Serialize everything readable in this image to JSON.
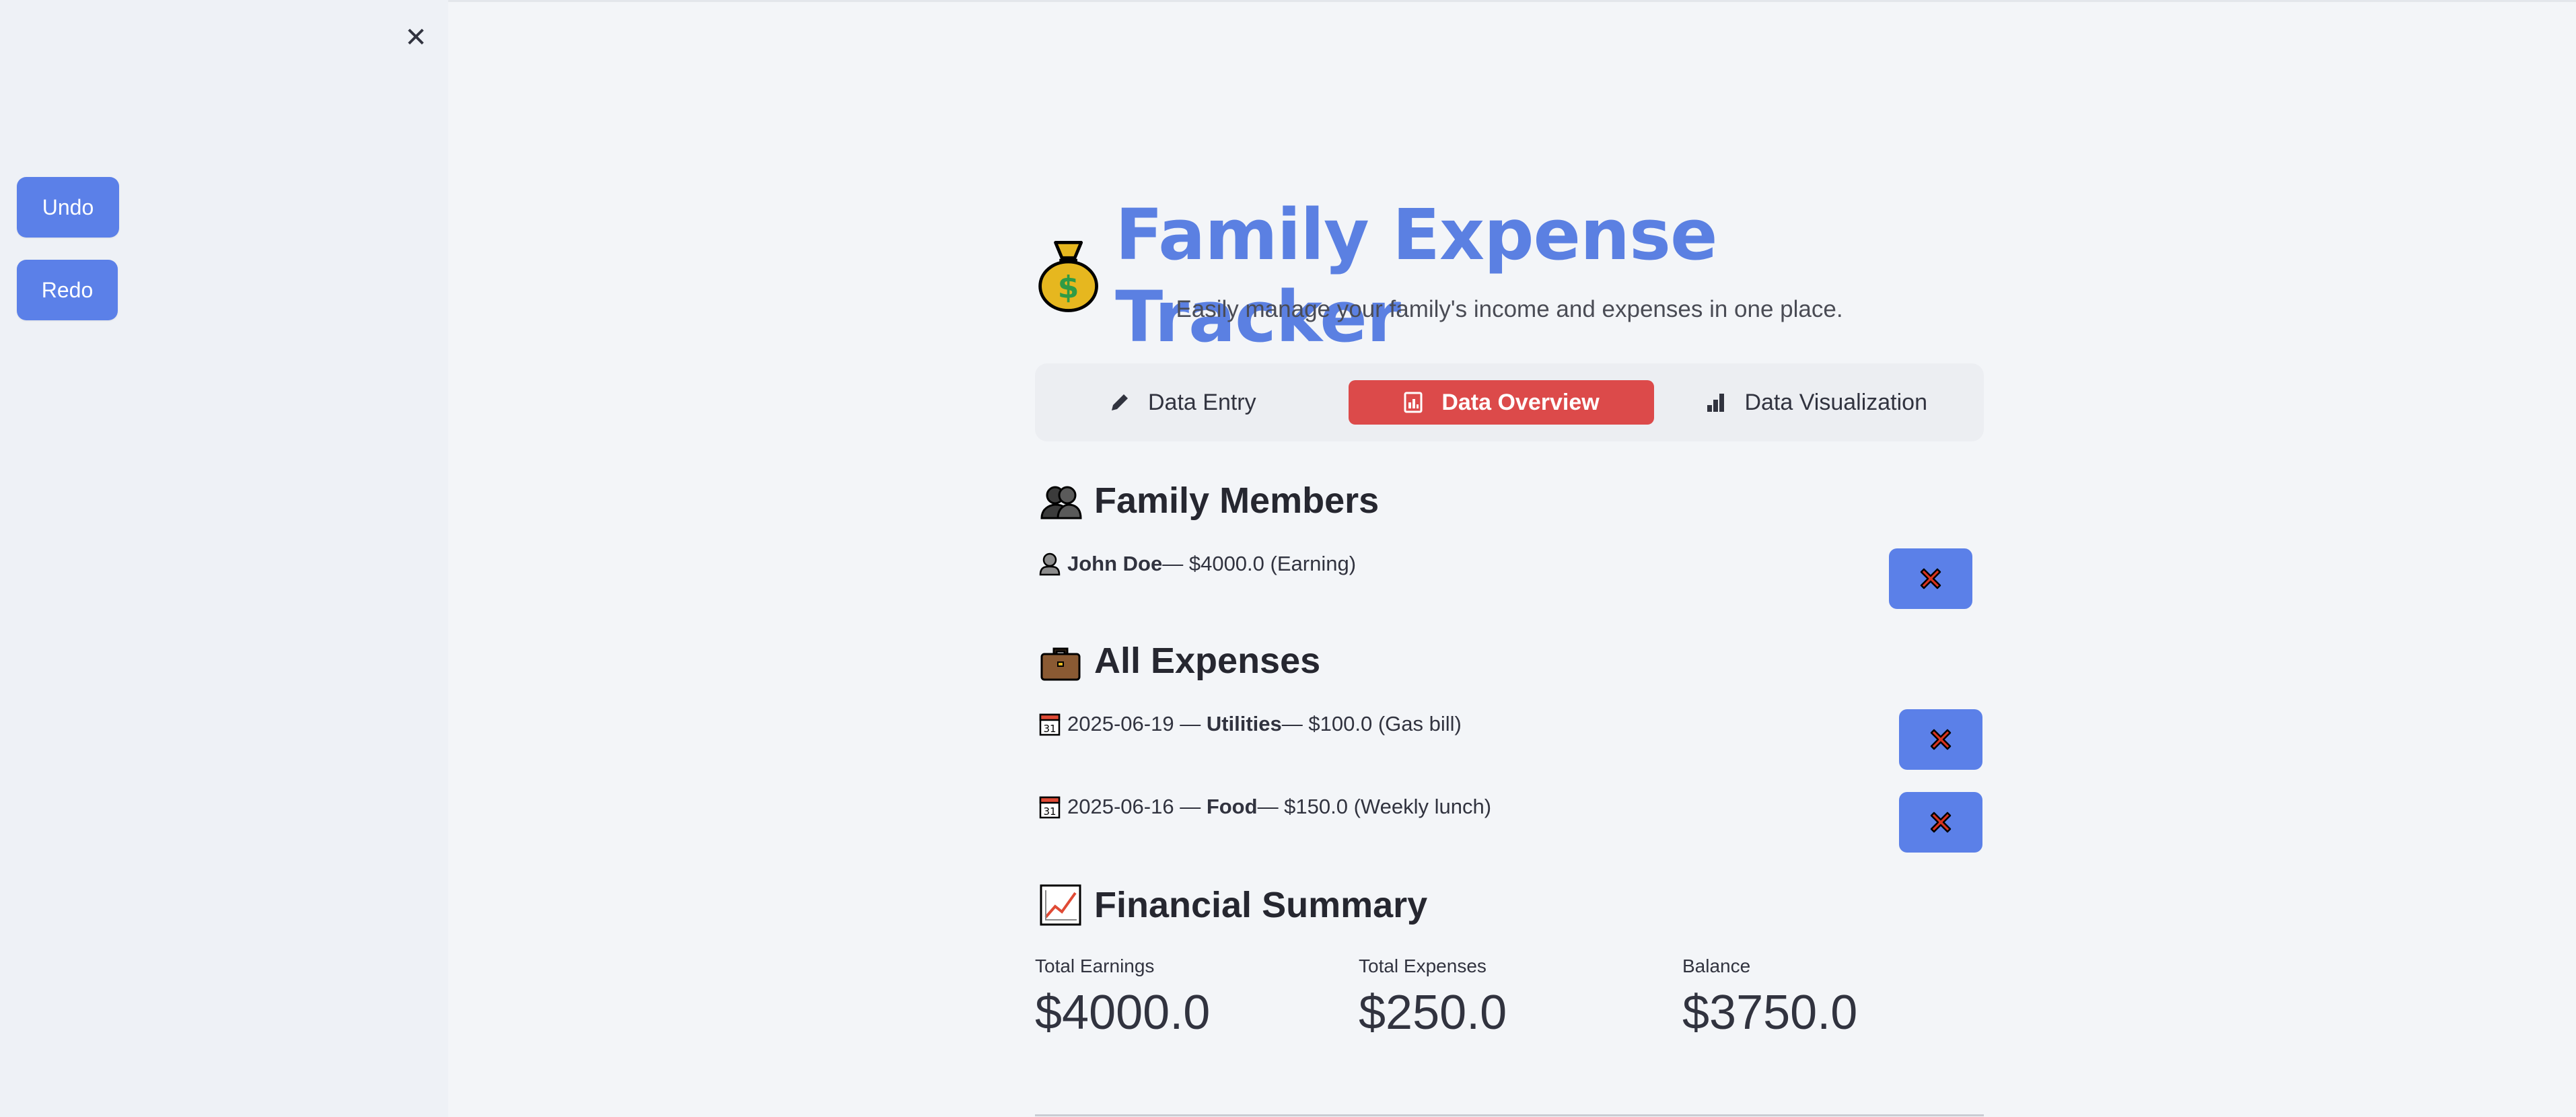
{
  "sidebar": {
    "close_icon": "close-icon",
    "undo_label": "Undo",
    "redo_label": "Redo"
  },
  "header": {
    "title": "Family Expense Tracker",
    "subtitle": "Easily manage your family's income and expenses in one place.",
    "icon": "money-bag-icon"
  },
  "tabs": [
    {
      "label": "Data Entry",
      "icon": "pencil-icon",
      "active": false
    },
    {
      "label": "Data Overview",
      "icon": "chart-icon",
      "active": true
    },
    {
      "label": "Data Visualization",
      "icon": "bar-chart-icon",
      "active": false
    }
  ],
  "family": {
    "heading": "Family Members",
    "members": [
      {
        "name": "John Doe",
        "detail": " — $4000.0 (Earning)"
      }
    ]
  },
  "expenses": {
    "heading": "All Expenses",
    "items": [
      {
        "date": "2025-06-19",
        "category": "Utilities",
        "detail": " — $100.0 (Gas bill)"
      },
      {
        "date": "2025-06-16",
        "category": "Food",
        "detail": " — $150.0 (Weekly lunch)"
      }
    ]
  },
  "summary": {
    "heading": "Financial Summary",
    "metrics": [
      {
        "label": "Total Earnings",
        "value": "$4000.0"
      },
      {
        "label": "Total Expenses",
        "value": "$250.0"
      },
      {
        "label": "Balance",
        "value": "$3750.0"
      }
    ]
  },
  "colors": {
    "accent": "#5b80e8",
    "active_tab": "#dc4a4a",
    "title": "#5b80e2",
    "background": "#f3f5f8",
    "sidebar": "#eef1f6"
  }
}
